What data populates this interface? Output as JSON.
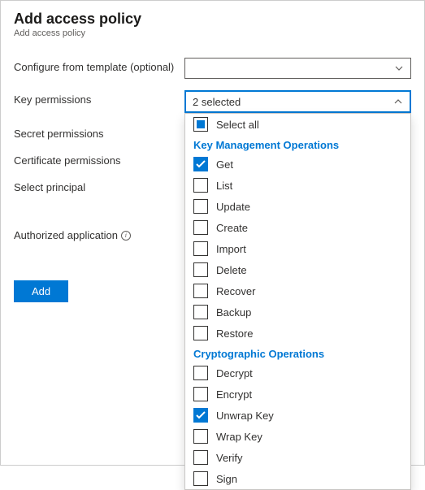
{
  "header": {
    "title": "Add access policy",
    "subtitle": "Add access policy"
  },
  "labels": {
    "template": "Configure from template (optional)",
    "keyPerms": "Key permissions",
    "secretPerms": "Secret permissions",
    "certPerms": "Certificate permissions",
    "selectPrincipal": "Select principal",
    "authApp": "Authorized application"
  },
  "keyDropdown": {
    "summary": "2 selected",
    "selectAll": "Select all",
    "groups": [
      {
        "name": "Key Management Operations",
        "items": [
          {
            "label": "Get",
            "checked": true
          },
          {
            "label": "List",
            "checked": false
          },
          {
            "label": "Update",
            "checked": false
          },
          {
            "label": "Create",
            "checked": false
          },
          {
            "label": "Import",
            "checked": false
          },
          {
            "label": "Delete",
            "checked": false
          },
          {
            "label": "Recover",
            "checked": false
          },
          {
            "label": "Backup",
            "checked": false
          },
          {
            "label": "Restore",
            "checked": false
          }
        ]
      },
      {
        "name": "Cryptographic Operations",
        "items": [
          {
            "label": "Decrypt",
            "checked": false
          },
          {
            "label": "Encrypt",
            "checked": false
          },
          {
            "label": "Unwrap Key",
            "checked": true
          },
          {
            "label": "Wrap Key",
            "checked": false
          },
          {
            "label": "Verify",
            "checked": false
          },
          {
            "label": "Sign",
            "checked": false
          }
        ]
      }
    ]
  },
  "buttons": {
    "add": "Add"
  }
}
